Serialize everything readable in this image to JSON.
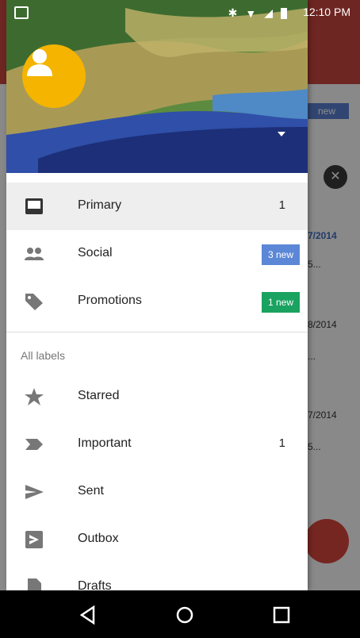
{
  "status_bar": {
    "time": "12:10 PM",
    "icons": [
      "notification-icon",
      "bluetooth-icon",
      "wifi-icon",
      "signal-icon",
      "battery-icon"
    ]
  },
  "background_app": {
    "chip": "new",
    "rows": [
      {
        "date": "7/2014",
        "snippet": "5..."
      },
      {
        "date": "8/2014",
        "snippet": "..."
      },
      {
        "date": "7/2014",
        "snippet": "5..."
      }
    ]
  },
  "drawer": {
    "items": [
      {
        "label": "Primary",
        "count": "1",
        "icon": "inbox-icon",
        "selected": true
      },
      {
        "label": "Social",
        "badge": "3 new",
        "badge_color": "#5b87d6",
        "icon": "people-icon"
      },
      {
        "label": "Promotions",
        "badge": "1 new",
        "badge_color": "#1aa260",
        "icon": "tag-icon"
      }
    ],
    "section_title": "All labels",
    "labels": [
      {
        "label": "Starred",
        "icon": "star-icon"
      },
      {
        "label": "Important",
        "count": "1",
        "icon": "important-icon"
      },
      {
        "label": "Sent",
        "icon": "send-icon"
      },
      {
        "label": "Outbox",
        "icon": "outbox-icon"
      },
      {
        "label": "Drafts",
        "icon": "drafts-icon"
      }
    ]
  },
  "nav_bar": {
    "buttons": [
      "back-icon",
      "home-icon",
      "recents-icon"
    ]
  }
}
